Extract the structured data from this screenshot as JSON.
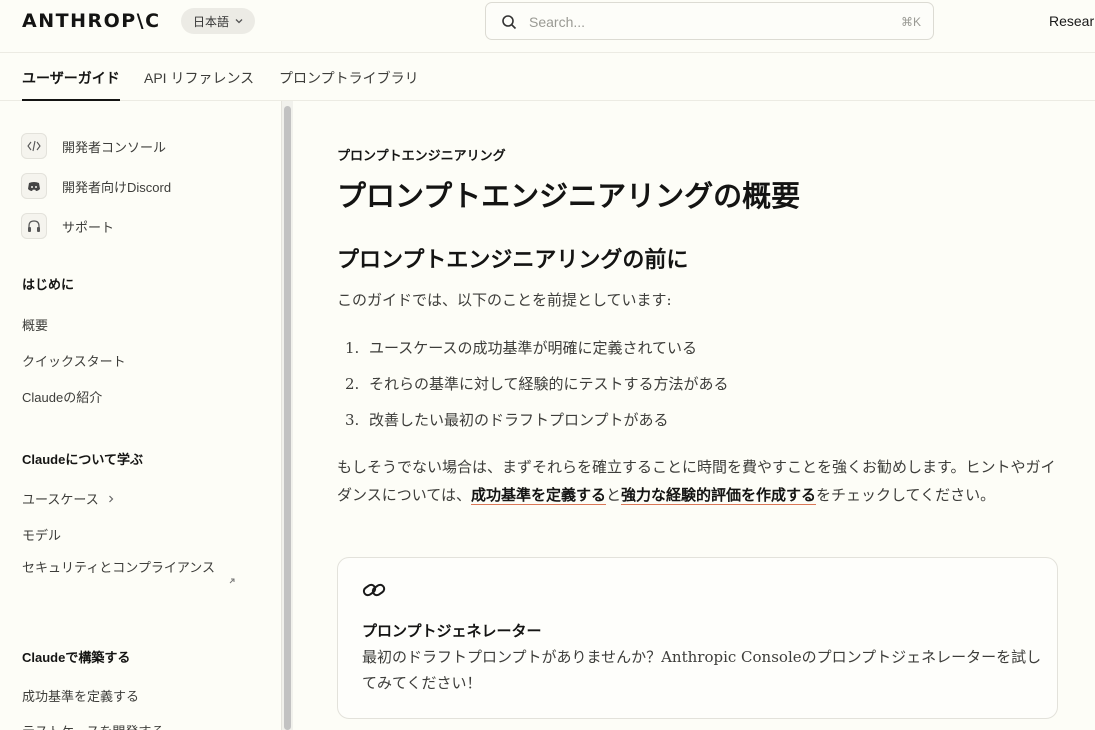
{
  "header": {
    "logo": "ANTHROP\\C",
    "language": "日本語",
    "search_placeholder": "Search...",
    "search_shortcut": "⌘K",
    "research_link": "Resear"
  },
  "tabs": [
    {
      "label": "ユーザーガイド",
      "active": true
    },
    {
      "label": "API リファレンス",
      "active": false
    },
    {
      "label": "プロンプトライブラリ",
      "active": false
    }
  ],
  "sidebar": {
    "links": [
      {
        "icon": "code-icon",
        "label": "開発者コンソール"
      },
      {
        "icon": "discord-icon",
        "label": "開発者向けDiscord"
      },
      {
        "icon": "headset-icon",
        "label": "サポート"
      }
    ],
    "sections": [
      {
        "title": "はじめに",
        "items": [
          "概要",
          "クイックスタート",
          "Claudeの紹介"
        ]
      },
      {
        "title": "Claudeについて学ぶ",
        "items": [
          "ユースケース",
          "モデル",
          "セキュリティとコンプライアンス"
        ]
      },
      {
        "title": "Claudeで構築する",
        "items": [
          "成功基準を定義する",
          "テストケースを開発する"
        ]
      }
    ]
  },
  "content": {
    "eyebrow": "プロンプトエンジニアリング",
    "title": "プロンプトエンジニアリングの概要",
    "section_heading": "プロンプトエンジニアリングの前に",
    "intro": "このガイドでは、以下のことを前提としています:",
    "list": [
      {
        "num": "1.",
        "text": "ユースケースの成功基準が明確に定義されている"
      },
      {
        "num": "2.",
        "text": "それらの基準に対して経験的にテストする方法がある"
      },
      {
        "num": "3.",
        "text": "改善したい最初のドラフトプロンプトがある"
      }
    ],
    "para_before": "もしそうでない場合は、まずそれらを確立することに時間を費やすことを強くお勧めします。ヒントやガイダンスについては、",
    "link1": "成功基準を定義する",
    "para_mid": "と",
    "link2": "強力な経験的評価を作成する",
    "para_after": "をチェックしてください。",
    "card": {
      "icon": "link-icon",
      "title": "プロンプトジェネレーター",
      "body": "最初のドラフトプロンプトがありませんか？Anthropic Consoleのプロンプトジェネレーターを試してみてください！"
    }
  },
  "colors": {
    "background": "#fdfdf7",
    "link_underline": "#d97757",
    "text": "#141413"
  }
}
